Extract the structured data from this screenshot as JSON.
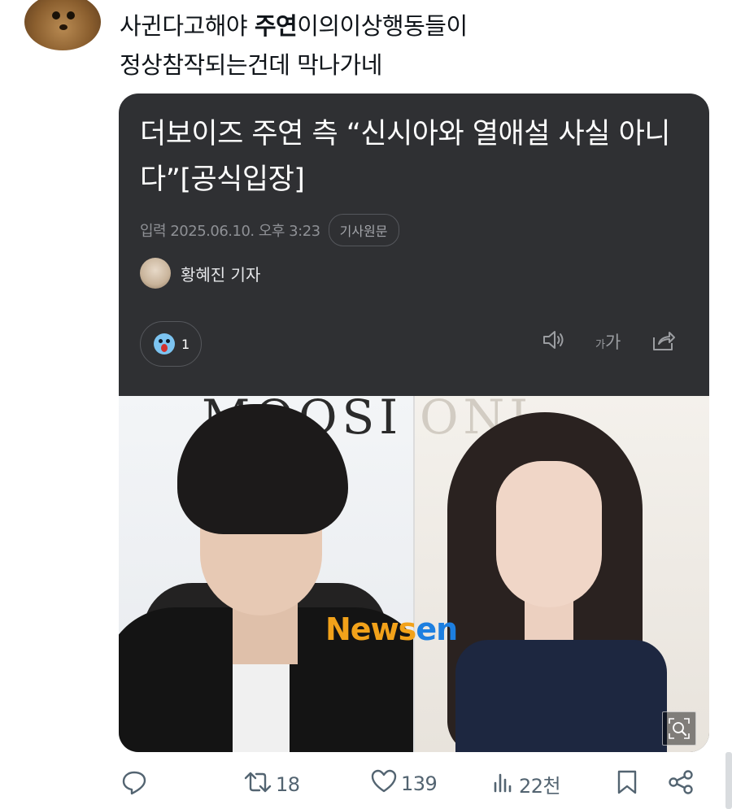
{
  "tweet": {
    "text_part1": "사귄다고해야 ",
    "text_bold": "주연",
    "text_part2": "이의이상행동들이",
    "text_line2": "정상참작되는건데 막나가네"
  },
  "article": {
    "headline": "더보이즈 주연 측 “신시아와 열애설 사실 아니다”[공식입장]",
    "date": "입력 2025.06.10. 오후 3:23",
    "original_button": "기사원문",
    "reporter": "황혜진 기자",
    "reaction_count": "1",
    "font_size_label_small": "가",
    "font_size_label_large": "가",
    "photo_signs": {
      "left": "MOOSI",
      "right": "ONI"
    },
    "watermark": {
      "part1": "News",
      "part2": "en"
    }
  },
  "actions": {
    "retweets": "18",
    "likes": "139",
    "views": "22천"
  },
  "icons": {
    "reply": "reply-icon",
    "retweet": "retweet-icon",
    "like": "heart-icon",
    "views": "views-icon",
    "bookmark": "bookmark-icon",
    "share": "share-icon",
    "speaker": "speaker-icon",
    "article_share": "share-out-icon",
    "zoom": "zoom-icon"
  }
}
